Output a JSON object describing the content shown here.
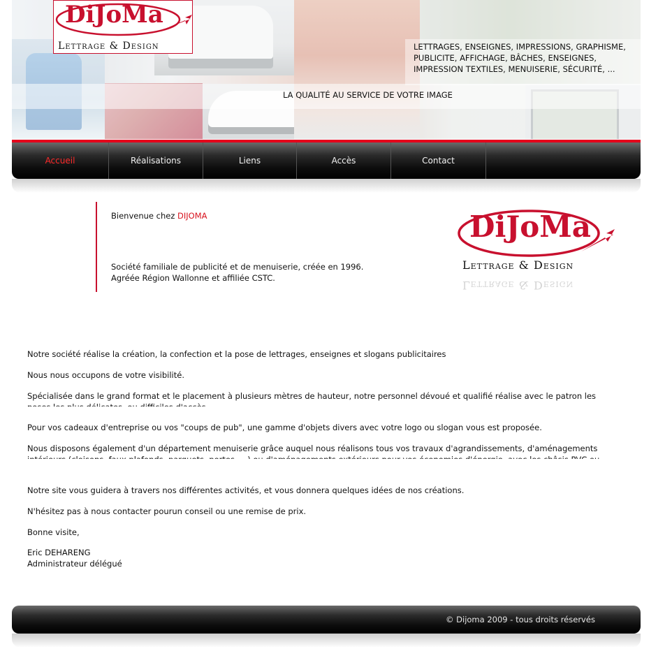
{
  "header": {
    "logo": {
      "word": "DiJoMa",
      "sub": "Lettrage & Design"
    },
    "tagline": "LETTRAGES, ENSEIGNES, IMPRESSIONS, GRAPHISME, PUBLICITE, AFFICHAGE, BÂCHES, ENSEIGNES, IMPRESSION TEXTILES, MENUISERIE, SÉCURITÉ, ...",
    "quality": "LA QUALITÉ AU SERVICE DE VOTRE IMAGE"
  },
  "nav": {
    "items": [
      {
        "label": "Accueil",
        "active": true
      },
      {
        "label": "Réalisations"
      },
      {
        "label": "Liens"
      },
      {
        "label": "Accès"
      },
      {
        "label": "Contact"
      }
    ]
  },
  "welcome": {
    "prefix": "Bienvenue chez ",
    "brand": "DIJOMA",
    "line1": "Société familiale de publicité et de menuiserie,  créée en 1996.",
    "line2": "Agréée Région Wallonne et affiliée CSTC."
  },
  "content": {
    "p1": "Notre société réalise la création, la confection et la pose de lettrages, enseignes et slogans publicitaires",
    "p2": "Nous nous occupons de votre visibilité.",
    "p3": "Spécialisée dans le grand format et le placement à plusieurs mètres de hauteur, notre personnel dévoué et qualifié réalise avec le patron les poses les plus délicates, ou difficiles d'accès.",
    "p4": "Pour vos cadeaux d'entreprise ou vos \"coups de pub\", une gamme d'objets divers avec votre logo ou slogan vous est proposée.",
    "p5": "Nous disposons également d'un département menuiserie grâce auquel nous réalisons tous vos travaux d'agrandissements, d'aménagements intérieurs (cloisons, faux plafonds, parquets, portes, ...) ou d'aménagements extérieurs pour vos économies d'énergie, avec les châsis PVC ou bois, et",
    "p6": "Notre site vous guidera à travers nos différentes activités, et vous donnera quelques idées de nos créations.",
    "p7": "N'hésitez pas à nous contacter pourun conseil ou une remise de prix.",
    "p8": "Bonne visite,",
    "sig_name": "Eric DEHARENG",
    "sig_title": "Administrateur délégué"
  },
  "footer": {
    "text": "© Dijoma 2009 - tous droits réservés"
  },
  "colors": {
    "brand_red": "#c8102e",
    "nav_active": "#ff2a2a",
    "accent_line": "#e4001b"
  }
}
